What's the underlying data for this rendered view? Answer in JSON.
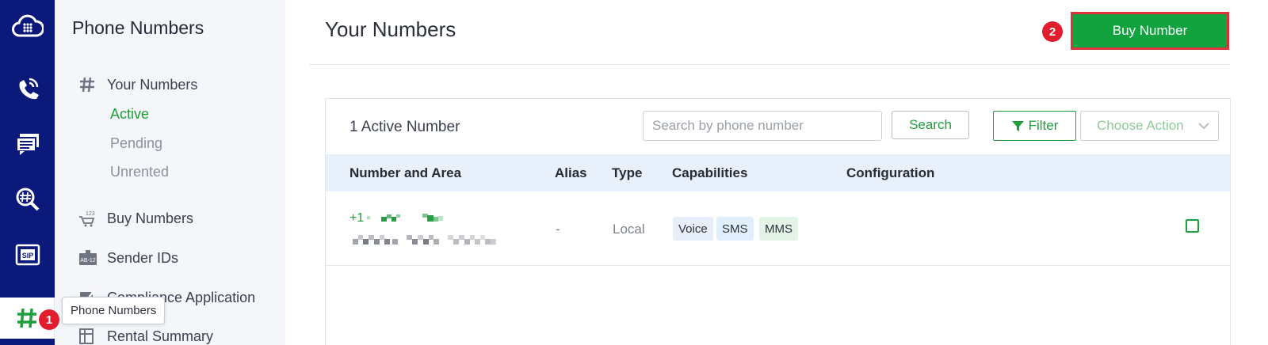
{
  "sidebar": {
    "rail_icons": [
      "cloud-dialpad-icon",
      "phone-call-icon",
      "messaging-icon",
      "number-lookup-icon",
      "sip-icon",
      "hash-icon"
    ],
    "title": "Phone Numbers",
    "items": [
      {
        "label": "Your Numbers",
        "icon": "hash-icon"
      },
      {
        "label": "Buy Numbers",
        "icon": "cart-icon"
      },
      {
        "label": "Sender IDs",
        "icon": "id-badge-icon"
      },
      {
        "label": "Compliance Application",
        "icon": "checkbox-icon"
      },
      {
        "label": "Rental Summary",
        "icon": "table-icon"
      }
    ],
    "subitems": [
      {
        "label": "Active",
        "active": true
      },
      {
        "label": "Pending",
        "active": false
      },
      {
        "label": "Unrented",
        "active": false
      }
    ],
    "tooltip": "Phone Numbers"
  },
  "markers": [
    "1",
    "2"
  ],
  "header": {
    "title": "Your Numbers",
    "buy_button": "Buy Number"
  },
  "toolbar": {
    "count": "1 Active Number",
    "search_placeholder": "Search by phone number",
    "search_button": "Search",
    "filter_button": "Filter",
    "action_select": "Choose Action"
  },
  "table": {
    "columns": [
      "Number and Area",
      "Alias",
      "Type",
      "Capabilities",
      "Configuration"
    ],
    "rows": [
      {
        "number_prefix": "+1",
        "alias": "-",
        "type": "Local",
        "capabilities": [
          "Voice",
          "SMS",
          "MMS"
        ]
      }
    ]
  },
  "colors": {
    "rail": "#0b1a7a",
    "accent_green": "#12a33e",
    "highlight_red": "#e0303c"
  }
}
